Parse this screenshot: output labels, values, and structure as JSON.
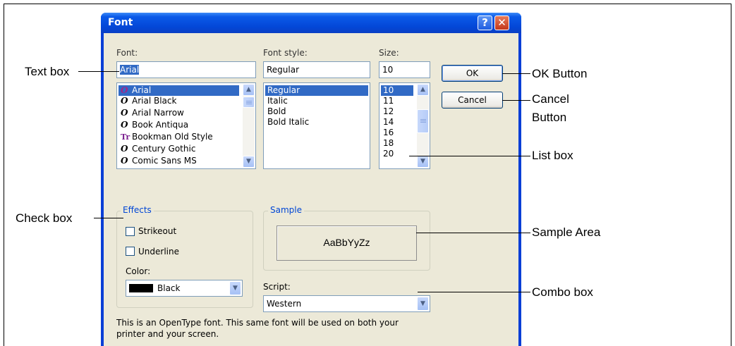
{
  "dialog": {
    "title": "Font",
    "help_glyph": "?",
    "close_glyph": "✕",
    "font_label": "Font:",
    "font_value": "Arial",
    "style_label": "Font style:",
    "style_value": "Regular",
    "size_label": "Size:",
    "size_value": "10",
    "fonts": [
      {
        "name": "Arial",
        "icon": "opentype-icon",
        "glyph": "O",
        "selected": true
      },
      {
        "name": "Arial Black",
        "icon": "opentype-icon",
        "glyph": "O"
      },
      {
        "name": "Arial Narrow",
        "icon": "opentype-icon",
        "glyph": "O"
      },
      {
        "name": "Book Antiqua",
        "icon": "opentype-icon",
        "glyph": "O"
      },
      {
        "name": "Bookman Old Style",
        "icon": "truetype-icon",
        "glyph": "Tr"
      },
      {
        "name": "Century Gothic",
        "icon": "opentype-icon",
        "glyph": "O"
      },
      {
        "name": "Comic Sans MS",
        "icon": "opentype-icon",
        "glyph": "O"
      }
    ],
    "styles": [
      "Regular",
      "Italic",
      "Bold",
      "Bold Italic"
    ],
    "sizes": [
      "10",
      "11",
      "12",
      "14",
      "16",
      "18",
      "20"
    ],
    "ok_label": "OK",
    "cancel_label": "Cancel",
    "effects_label": "Effects",
    "strikeout_label": "Strikeout",
    "underline_label": "Underline",
    "color_label": "Color:",
    "color_value": "Black",
    "sample_label": "Sample",
    "sample_text": "AaBbYyZz",
    "script_label": "Script:",
    "script_value": "Western",
    "info_line1": "This is an OpenType font. This same font will be used on both your",
    "info_line2": "printer and your screen.",
    "colors": {
      "title": "#0347d7",
      "selection": "#316ac5",
      "group_title": "#0046d5",
      "face": "#ece9d8"
    }
  },
  "callouts": {
    "text_box": "Text box",
    "check_box": "Check box",
    "ok_button": "OK Button",
    "cancel_button_1": "Cancel",
    "cancel_button_2": "Button",
    "list_box": "List box",
    "sample_area": "Sample Area",
    "combo_box": "Combo box"
  }
}
